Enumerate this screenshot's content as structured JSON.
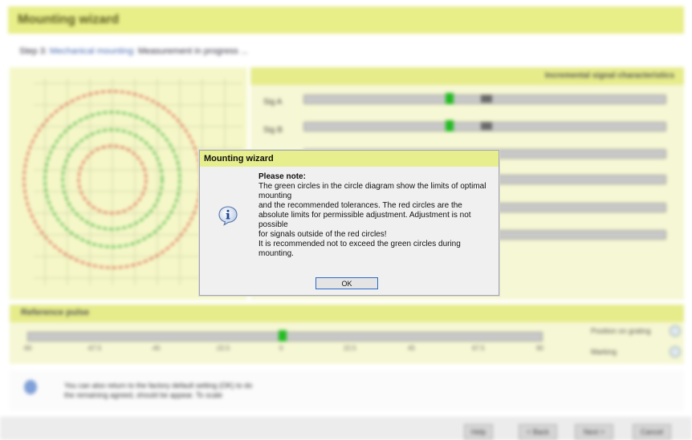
{
  "app": {
    "title": "Mounting wizard",
    "step_prefix": "Step 3: ",
    "step_link": "Mechanical mounting: ",
    "step_status": "Measurement in progress ..."
  },
  "signals": {
    "heading": "Incremental signal characteristics",
    "meters": [
      {
        "label": "Sig A",
        "level": 0.4
      },
      {
        "label": "Sig B",
        "level": 0.4
      },
      {
        "label": "",
        "level": 0.0
      },
      {
        "label": "",
        "level": 0.0
      },
      {
        "label": "",
        "level": 0.0
      },
      {
        "label": "",
        "level": 0.0
      }
    ]
  },
  "reference": {
    "heading": "Reference pulse",
    "scale": [
      "-90",
      "-67.5",
      "-45",
      "-22.5",
      "0",
      "22.5",
      "45",
      "67.5",
      "90"
    ],
    "level": 0.5,
    "option_1": "Position on grating",
    "option_2": "Marking"
  },
  "info": {
    "line1": "You can also return to the factory default setting (OK) to do",
    "line2": "the remaining agreed, should be appear. To scale"
  },
  "nav": {
    "help": "Help",
    "back": "< Back",
    "next": "Next >",
    "cancel": "Cancel"
  },
  "dialog": {
    "title": "Mounting wizard",
    "note_heading": "Please note:",
    "lines": [
      "The green circles in the circle diagram show the limits of optimal mounting",
      "and the recommended tolerances. The red circles are the absolute limits for permissible adjustment. Adjustment is not possible",
      "for signals outside of the red circles!",
      "It is recommended not to exceed the green circles during mounting."
    ],
    "ok_label": "OK",
    "icon": "info-icon"
  },
  "colors": {
    "accent_yellow": "#e6ee8e",
    "panel_bg": "#f6f7d4",
    "optimal_circle": "#22aa22",
    "limit_circle": "#dd4433",
    "focus_border": "#2d6ac6"
  }
}
